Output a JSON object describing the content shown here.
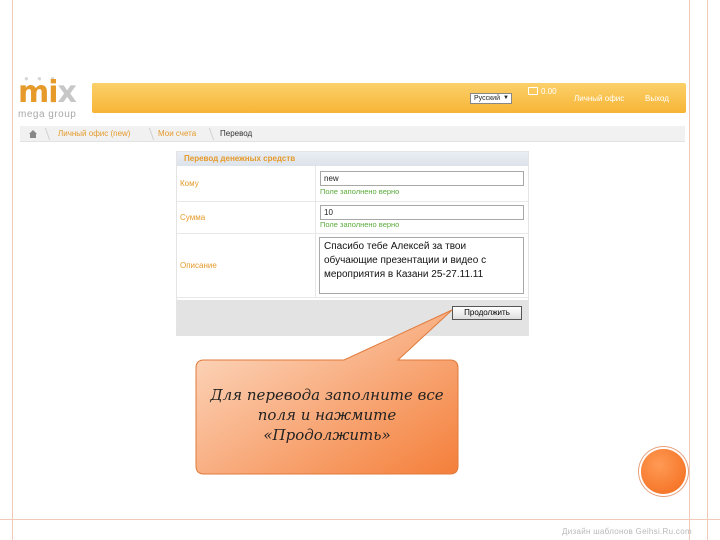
{
  "logo": {
    "word_main": "mi",
    "word_x": "x",
    "subtitle": "mega group"
  },
  "topbar": {
    "language": "Русский",
    "balance": "0.00",
    "links": [
      "Личный офис",
      "Выход"
    ],
    "wallet_icon": "wallet-icon",
    "accent": "#f7b536"
  },
  "breadcrumb": {
    "home_icon": "home-icon",
    "items": [
      "Личный офис (new)",
      "Мои счета",
      "Перевод"
    ]
  },
  "form": {
    "title": "Перевод денежных средств",
    "rows": [
      {
        "label": "Кому",
        "value": "new",
        "hint": "Поле заполнено верно"
      },
      {
        "label": "Сумма",
        "value": "10",
        "hint": "Поле заполнено верно"
      },
      {
        "label": "Описание",
        "value": "Спасибо тебе Алексей за твои обучающие презентации и видео с мероприятия в Казани 25-27.11.11"
      }
    ],
    "submit_label": "Продолжить"
  },
  "callout": {
    "text": "Для перевода заполните все поля и нажмите «Продолжить»",
    "fill": "#f58d4e"
  },
  "footer_note": "Дизайн шаблонов Geihsi.Ru.com"
}
